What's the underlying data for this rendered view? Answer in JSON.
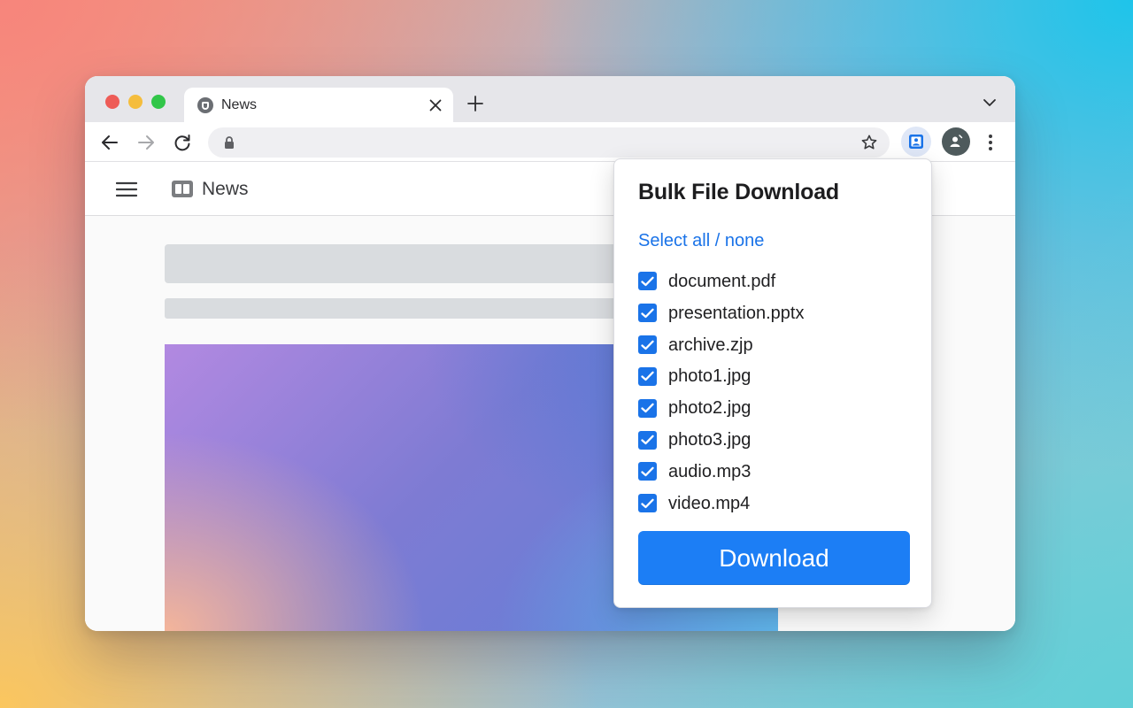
{
  "browser": {
    "tab": {
      "title": "News",
      "favicon_icon": "shield-favicon-icon",
      "close_icon": "close-icon"
    },
    "newtab_icon": "plus-icon",
    "tab_dropdown_icon": "chevron-down-icon",
    "toolbar": {
      "back_icon": "arrow-left-icon",
      "forward_icon": "arrow-right-icon",
      "reload_icon": "reload-icon",
      "address": "",
      "lock_icon": "lock-icon",
      "bookmark_icon": "star-icon",
      "extension_icon": "bulk-download-extension-icon",
      "profile_icon": "profile-avatar-icon",
      "menu_icon": "kebab-menu-icon"
    }
  },
  "site": {
    "menu_icon": "hamburger-menu-icon",
    "logo_icon": "news-logo-icon",
    "name": "News"
  },
  "popup": {
    "title": "Bulk File Download",
    "select_all_label": "Select all / none",
    "files": [
      {
        "name": "document.pdf",
        "checked": true
      },
      {
        "name": "presentation.pptx",
        "checked": true
      },
      {
        "name": "archive.zjp",
        "checked": true
      },
      {
        "name": "photo1.jpg",
        "checked": true
      },
      {
        "name": "photo2.jpg",
        "checked": true
      },
      {
        "name": "photo3.jpg",
        "checked": true
      },
      {
        "name": "audio.mp3",
        "checked": true
      },
      {
        "name": "video.mp4",
        "checked": true
      }
    ],
    "download_label": "Download"
  },
  "colors": {
    "accent": "#1a73e8",
    "download_button": "#1c7ef5",
    "traffic_red": "#ee5c57",
    "traffic_yellow": "#f5bd3d",
    "traffic_green": "#31c649"
  }
}
